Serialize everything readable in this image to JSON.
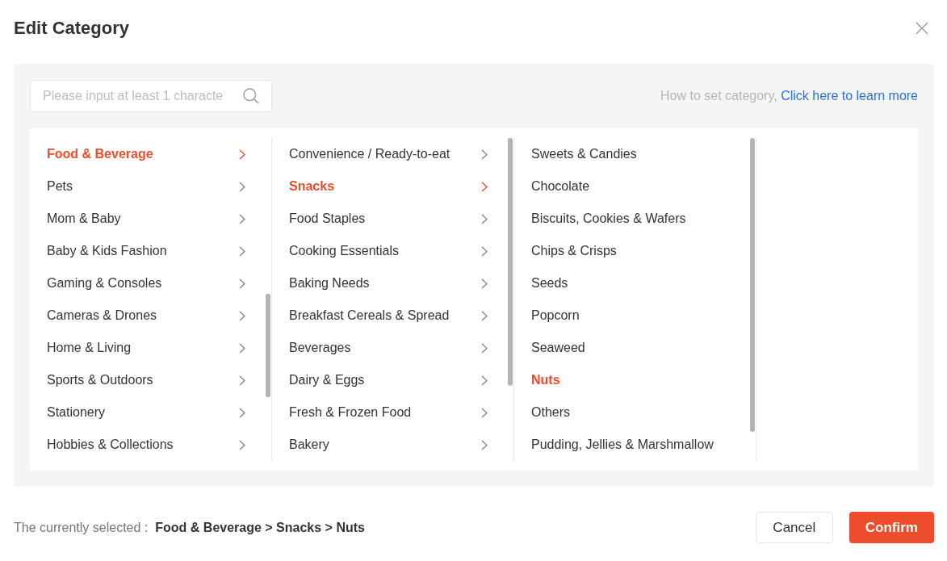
{
  "dialog": {
    "title": "Edit Category"
  },
  "search": {
    "placeholder": "Please input at least 1 characte"
  },
  "help": {
    "text": "How to set category,",
    "link": "Click here to learn more"
  },
  "columns": [
    {
      "items": [
        {
          "label": "Food & Beverage",
          "selected": true,
          "has_children": true
        },
        {
          "label": "Pets",
          "selected": false,
          "has_children": true
        },
        {
          "label": "Mom & Baby",
          "selected": false,
          "has_children": true
        },
        {
          "label": "Baby & Kids Fashion",
          "selected": false,
          "has_children": true
        },
        {
          "label": "Gaming & Consoles",
          "selected": false,
          "has_children": true
        },
        {
          "label": "Cameras & Drones",
          "selected": false,
          "has_children": true
        },
        {
          "label": "Home & Living",
          "selected": false,
          "has_children": true
        },
        {
          "label": "Sports & Outdoors",
          "selected": false,
          "has_children": true
        },
        {
          "label": "Stationery",
          "selected": false,
          "has_children": true
        },
        {
          "label": "Hobbies & Collections",
          "selected": false,
          "has_children": true
        }
      ]
    },
    {
      "items": [
        {
          "label": "Convenience / Ready-to-eat",
          "selected": false,
          "has_children": true
        },
        {
          "label": "Snacks",
          "selected": true,
          "has_children": true
        },
        {
          "label": "Food Staples",
          "selected": false,
          "has_children": true
        },
        {
          "label": "Cooking Essentials",
          "selected": false,
          "has_children": true
        },
        {
          "label": "Baking Needs",
          "selected": false,
          "has_children": true
        },
        {
          "label": "Breakfast Cereals & Spread",
          "selected": false,
          "has_children": true
        },
        {
          "label": "Beverages",
          "selected": false,
          "has_children": true
        },
        {
          "label": "Dairy & Eggs",
          "selected": false,
          "has_children": true
        },
        {
          "label": "Fresh & Frozen Food",
          "selected": false,
          "has_children": true
        },
        {
          "label": "Bakery",
          "selected": false,
          "has_children": true
        }
      ]
    },
    {
      "items": [
        {
          "label": "Sweets & Candies",
          "selected": false,
          "has_children": false
        },
        {
          "label": "Chocolate",
          "selected": false,
          "has_children": false
        },
        {
          "label": "Biscuits, Cookies & Wafers",
          "selected": false,
          "has_children": false
        },
        {
          "label": "Chips & Crisps",
          "selected": false,
          "has_children": false
        },
        {
          "label": "Seeds",
          "selected": false,
          "has_children": false
        },
        {
          "label": "Popcorn",
          "selected": false,
          "has_children": false
        },
        {
          "label": "Seaweed",
          "selected": false,
          "has_children": false
        },
        {
          "label": "Nuts",
          "selected": true,
          "has_children": false
        },
        {
          "label": "Others",
          "selected": false,
          "has_children": false
        },
        {
          "label": "Pudding, Jellies & Marshmallow",
          "selected": false,
          "has_children": false
        }
      ]
    }
  ],
  "footer": {
    "label": "The currently selected :",
    "selected_path": "Food & Beverage > Snacks > Nuts",
    "buttons": [
      {
        "label": "Cancel",
        "kind": "secondary"
      },
      {
        "label": "Confirm",
        "kind": "primary"
      }
    ]
  }
}
